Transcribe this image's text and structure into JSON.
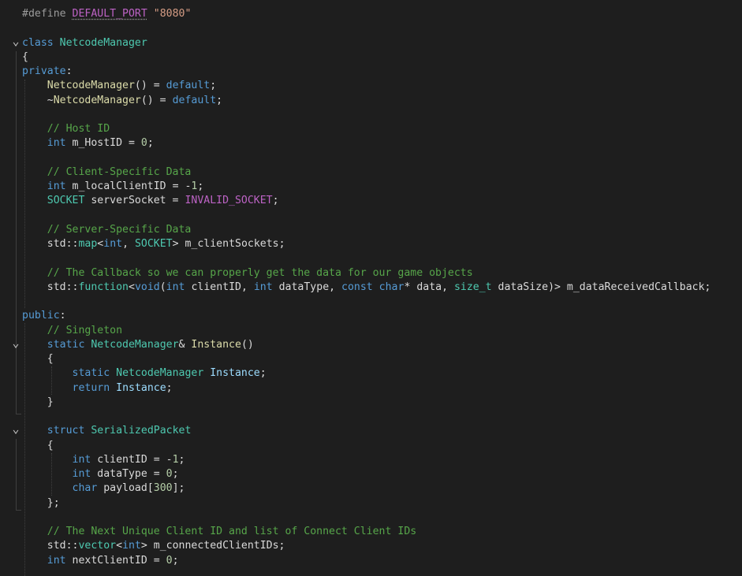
{
  "editor": {
    "lines": [
      [
        [
          "pp",
          "#define "
        ],
        [
          "mc",
          "DEFAULT_PORT"
        ],
        [
          "va",
          " "
        ],
        [
          "st",
          "\"8080\""
        ]
      ],
      [],
      [
        [
          "kw",
          "class "
        ],
        [
          "ty",
          "NetcodeManager"
        ]
      ],
      [
        [
          "va",
          "{"
        ]
      ],
      [
        [
          "kw",
          "private"
        ],
        [
          "va",
          ":"
        ]
      ],
      [
        [
          "va",
          "    "
        ],
        [
          "fn",
          "NetcodeManager"
        ],
        [
          "va",
          "() = "
        ],
        [
          "kw",
          "default"
        ],
        [
          "va",
          ";"
        ]
      ],
      [
        [
          "va",
          "    ~"
        ],
        [
          "fn",
          "NetcodeManager"
        ],
        [
          "va",
          "() = "
        ],
        [
          "kw",
          "default"
        ],
        [
          "va",
          ";"
        ]
      ],
      [],
      [
        [
          "va",
          "    "
        ],
        [
          "cm",
          "// Host ID"
        ]
      ],
      [
        [
          "va",
          "    "
        ],
        [
          "kw",
          "int"
        ],
        [
          "va",
          " m_HostID = "
        ],
        [
          "nm",
          "0"
        ],
        [
          "va",
          ";"
        ]
      ],
      [],
      [
        [
          "va",
          "    "
        ],
        [
          "cm",
          "// Client-Specific Data"
        ]
      ],
      [
        [
          "va",
          "    "
        ],
        [
          "kw",
          "int"
        ],
        [
          "va",
          " m_localClientID = -"
        ],
        [
          "nm",
          "1"
        ],
        [
          "va",
          ";"
        ]
      ],
      [
        [
          "va",
          "    "
        ],
        [
          "ty",
          "SOCKET"
        ],
        [
          "va",
          " serverSocket = "
        ],
        [
          "mc",
          "INVALID_SOCKET"
        ],
        [
          "va",
          ";"
        ]
      ],
      [],
      [
        [
          "va",
          "    "
        ],
        [
          "cm",
          "// Server-Specific Data"
        ]
      ],
      [
        [
          "va",
          "    std::"
        ],
        [
          "ty",
          "map"
        ],
        [
          "va",
          "<"
        ],
        [
          "kw",
          "int"
        ],
        [
          "va",
          ", "
        ],
        [
          "ty",
          "SOCKET"
        ],
        [
          "va",
          "> m_clientSockets;"
        ]
      ],
      [],
      [
        [
          "va",
          "    "
        ],
        [
          "cm",
          "// The Callback so we can properly get the data for our game objects"
        ]
      ],
      [
        [
          "va",
          "    std::"
        ],
        [
          "ty",
          "function"
        ],
        [
          "va",
          "<"
        ],
        [
          "kw",
          "void"
        ],
        [
          "va",
          "("
        ],
        [
          "kw",
          "int"
        ],
        [
          "va",
          " clientID, "
        ],
        [
          "kw",
          "int"
        ],
        [
          "va",
          " dataType, "
        ],
        [
          "kw",
          "const"
        ],
        [
          "va",
          " "
        ],
        [
          "kw",
          "char"
        ],
        [
          "va",
          "* data, "
        ],
        [
          "ty",
          "size_t"
        ],
        [
          "va",
          " dataSize)> m_dataReceivedCallback;"
        ]
      ],
      [],
      [
        [
          "kw",
          "public"
        ],
        [
          "va",
          ":"
        ]
      ],
      [
        [
          "va",
          "    "
        ],
        [
          "cm",
          "// Singleton"
        ]
      ],
      [
        [
          "va",
          "    "
        ],
        [
          "kw",
          "static"
        ],
        [
          "va",
          " "
        ],
        [
          "ty",
          "NetcodeManager"
        ],
        [
          "va",
          "& "
        ],
        [
          "fn",
          "Instance"
        ],
        [
          "va",
          "()"
        ]
      ],
      [
        [
          "va",
          "    {"
        ]
      ],
      [
        [
          "va",
          "        "
        ],
        [
          "kw",
          "static"
        ],
        [
          "va",
          " "
        ],
        [
          "ty",
          "NetcodeManager"
        ],
        [
          "va",
          " "
        ],
        [
          "pa",
          "Instance"
        ],
        [
          "va",
          ";"
        ]
      ],
      [
        [
          "va",
          "        "
        ],
        [
          "kw",
          "return"
        ],
        [
          "va",
          " "
        ],
        [
          "pa",
          "Instance"
        ],
        [
          "va",
          ";"
        ]
      ],
      [
        [
          "va",
          "    }"
        ]
      ],
      [],
      [
        [
          "va",
          "    "
        ],
        [
          "kw",
          "struct"
        ],
        [
          "va",
          " "
        ],
        [
          "ty",
          "SerializedPacket"
        ]
      ],
      [
        [
          "va",
          "    {"
        ]
      ],
      [
        [
          "va",
          "        "
        ],
        [
          "kw",
          "int"
        ],
        [
          "va",
          " clientID = -"
        ],
        [
          "nm",
          "1"
        ],
        [
          "va",
          ";"
        ]
      ],
      [
        [
          "va",
          "        "
        ],
        [
          "kw",
          "int"
        ],
        [
          "va",
          " dataType = "
        ],
        [
          "nm",
          "0"
        ],
        [
          "va",
          ";"
        ]
      ],
      [
        [
          "va",
          "        "
        ],
        [
          "kw",
          "char"
        ],
        [
          "va",
          " payload["
        ],
        [
          "nm",
          "300"
        ],
        [
          "va",
          "];"
        ]
      ],
      [
        [
          "va",
          "    };"
        ]
      ],
      [],
      [
        [
          "va",
          "    "
        ],
        [
          "cm",
          "// The Next Unique Client ID and list of Connect Client IDs"
        ]
      ],
      [
        [
          "va",
          "    std::"
        ],
        [
          "ty",
          "vector"
        ],
        [
          "va",
          "<"
        ],
        [
          "kw",
          "int"
        ],
        [
          "va",
          "> m_connectedClientIDs;"
        ]
      ],
      [
        [
          "va",
          "    "
        ],
        [
          "kw",
          "int"
        ],
        [
          "va",
          " nextClientID = "
        ],
        [
          "nm",
          "0"
        ],
        [
          "va",
          ";"
        ]
      ]
    ],
    "fold_markers": {
      "2": "chevron-down",
      "23": "chevron-down",
      "29": "chevron-down"
    },
    "colors": {
      "background": "#1e1e1e",
      "keyword": "#569cd6",
      "type": "#4ec9b0",
      "function": "#dcdcaa",
      "comment": "#57a64a",
      "string": "#d69d85",
      "number": "#b5cea8",
      "macro": "#bd63c5"
    }
  }
}
